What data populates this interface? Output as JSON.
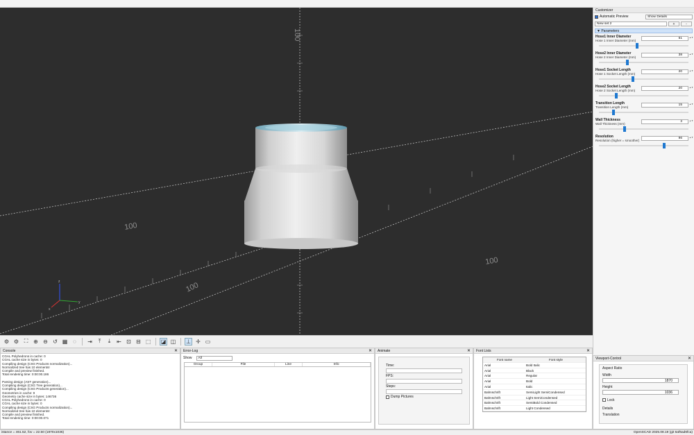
{
  "viewport": {
    "axis_labels": {
      "y_top": "100",
      "x_left": "100",
      "x_right": "100",
      "y_bottom": "100"
    },
    "small_axis": {
      "x": "x",
      "y": "y",
      "z": "z"
    }
  },
  "toolbar_icons": [
    "preview-icon",
    "render-icon",
    "zoom-all-icon",
    "zoom-in-icon",
    "zoom-out-icon",
    "reset-view-icon",
    "view-all-icon",
    "right-view-icon",
    "top-view-icon",
    "bottom-view-icon",
    "left-view-icon",
    "front-view-icon",
    "back-view-icon",
    "perspective-icon",
    "orthogonal-icon",
    "axes-icon",
    "crosshairs-icon",
    "edges-icon"
  ],
  "customizer": {
    "title": "Customizer",
    "auto_preview_label": "Automatic Preview",
    "detail_select": "Show Details",
    "preset": "New set 2",
    "add_label": "+",
    "remove_label": "-",
    "parameters_label": "Parameters",
    "params": [
      {
        "name": "Hose1 Inner Diameter",
        "desc": "Hose 1 Inner Diameter (mm)",
        "value": "51",
        "fraction": 0.43
      },
      {
        "name": "Hose2 Inner Diameter",
        "desc": "Hose 2 Inner Diameter (mm)",
        "value": "38",
        "fraction": 0.32
      },
      {
        "name": "Hose1 Socket Length",
        "desc": "Hose 1 Socket Length (mm)",
        "value": "20",
        "fraction": 0.38
      },
      {
        "name": "Hose2 Socket Length",
        "desc": "Hose 2 Socket Length (mm)",
        "value": "20",
        "fraction": 0.19
      },
      {
        "name": "Transition Length",
        "desc": "Transition Length (mm)",
        "value": "15",
        "fraction": 0.16
      },
      {
        "name": "Wall Thickness",
        "desc": "Wall Thickness (mm)",
        "value": "3",
        "fraction": 0.29
      },
      {
        "name": "Resolution",
        "desc": "Resolution (higher = smoother)",
        "value": "96",
        "fraction": 0.73
      }
    ]
  },
  "console": {
    "title": "Console",
    "lines": [
      "CGAL Polyhedrons in cache: 0",
      "CGAL cache size in bytes: 0",
      "Compiling design (CSG Products normalization)...",
      "Normalized tree has 10 elements!",
      "Compile and preview finished.",
      "Total rendering time: 0:00:00.186",
      "",
      "Parsing design (AST generation)...",
      "Compiling design (CSG Tree generation)...",
      "Compiling design (CSG Products generation)...",
      "Geometries in cache: 9",
      "Geometry cache size in bytes: 146736",
      "CGAL Polyhedrons in cache: 0",
      "CGAL cache size in bytes: 0",
      "Compiling design (CSG Products normalization)...",
      "Normalized tree has 10 elements!",
      "Compile and preview finished.",
      "Total rendering time: 0:00:00.071"
    ]
  },
  "errorlog": {
    "title": "Error-Log",
    "show_label": "Show",
    "show_value": "All",
    "columns": [
      "Group",
      "File",
      "Line",
      "Info"
    ]
  },
  "animate": {
    "title": "Animate",
    "time_label": "Time:",
    "fps_label": "FPS:",
    "steps_label": "Steps:",
    "dump_label": "Dump Pictures"
  },
  "fontlists": {
    "title": "Font Lists",
    "columns": [
      "Font name",
      "Font style"
    ],
    "rows": [
      [
        "Arial",
        "Bold Italic"
      ],
      [
        "Arial",
        "Black"
      ],
      [
        "Arial",
        "Regular"
      ],
      [
        "Arial",
        "Bold"
      ],
      [
        "Arial",
        "Italic"
      ],
      [
        "Bahnschrift",
        "SemiLight SemiCondensed"
      ],
      [
        "Bahnschrift",
        "Light SemiCondensed"
      ],
      [
        "Bahnschrift",
        "SemiBold Condensed"
      ],
      [
        "Bahnschrift",
        "Light Condensed"
      ]
    ]
  },
  "viewport_control": {
    "title": "Viewport-Control",
    "aspect_label": "Aspect Ratio",
    "width_label": "Width",
    "width_value": "1870",
    "height_label": "Height",
    "height_value": "1036",
    "lock_label": "Lock",
    "details_label": "Details",
    "translation_label": "Translation"
  },
  "status": {
    "left": "istance = 461.52, fov = 22.50 (1870x1036)",
    "right": "OpenSCAD 2025.08.19 (git 6af6ad6fca)"
  }
}
